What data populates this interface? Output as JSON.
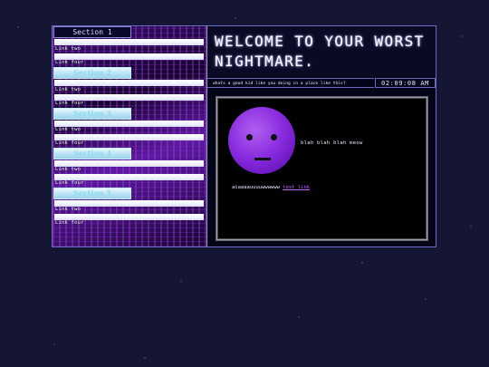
{
  "sidebar": {
    "sections": [
      {
        "title": "Section 1",
        "links": [
          "Link two",
          "Link four"
        ]
      },
      {
        "title": "Section 2",
        "links": [
          "Link two",
          "Link four"
        ]
      },
      {
        "title": "Section 3",
        "links": [
          "Link two",
          "Link four"
        ]
      },
      {
        "title": "Section 4",
        "links": [
          "Link two",
          "Link four"
        ]
      },
      {
        "title": "Section 5",
        "links": [
          "Link two",
          "Link four"
        ]
      }
    ]
  },
  "header": {
    "title": "WELCOME TO YOUR WORST NIGHTMARE.",
    "tagline": "whats a good kid like you doing in a place like this?",
    "clock": "02:09:08 AM"
  },
  "content": {
    "blah": "blah blah blah meow",
    "scream": "aiaaaauuuuwwwwww",
    "test_link": "test link"
  },
  "colors": {
    "background": "#141633",
    "face": "#8a2ee0",
    "link": "#c060ff",
    "section_head": "#b8e4f4"
  }
}
